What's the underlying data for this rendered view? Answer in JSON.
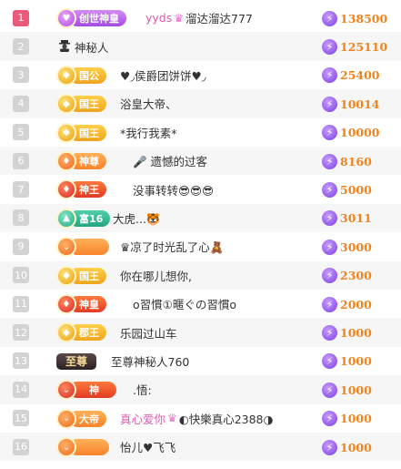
{
  "accent_color": "#f0831d",
  "score_icon": "lightning-bolt-icon",
  "rows": [
    {
      "rank": "1",
      "badge": "创世神皇",
      "badge_style": "purple",
      "name": "yyds",
      "name_suffix": "溜达溜达777",
      "name_color": "pink-prefix",
      "score": "138500"
    },
    {
      "rank": "2",
      "badge": "",
      "badge_style": "none",
      "name": "神秘人",
      "score": "125110"
    },
    {
      "rank": "3",
      "badge": "国公",
      "badge_style": "gold",
      "name": "♥◞侯爵团饼饼♥◞",
      "score": "25400"
    },
    {
      "rank": "4",
      "badge": "国王",
      "badge_style": "gold",
      "name": "浴皇大帝、",
      "score": "10014"
    },
    {
      "rank": "5",
      "badge": "国王",
      "badge_style": "gold",
      "name": "*我行我素*",
      "score": "10000"
    },
    {
      "rank": "6",
      "badge": "神尊",
      "badge_style": "orange",
      "name": "🎤 遗憾的过客",
      "score": "8160"
    },
    {
      "rank": "7",
      "badge": "神王",
      "badge_style": "red",
      "name": "没事转转😎😎😎",
      "score": "5000"
    },
    {
      "rank": "8",
      "badge": "富16",
      "badge_style": "teal",
      "name": "大虎...🐯",
      "score": "3011"
    },
    {
      "rank": "9",
      "badge": "",
      "badge_style": "orange",
      "name": "♛凉了时光乱了心🧸",
      "score": "3000"
    },
    {
      "rank": "10",
      "badge": "国王",
      "badge_style": "gold",
      "name": "你在哪儿想你,",
      "score": "2300"
    },
    {
      "rank": "11",
      "badge": "神皇",
      "badge_style": "red",
      "name": "o習慣①暱ぐの習慣o",
      "score": "2000"
    },
    {
      "rank": "12",
      "badge": "郡王",
      "badge_style": "gold",
      "name": "乐园过山车",
      "score": "1000"
    },
    {
      "rank": "13",
      "badge": "至尊",
      "badge_style": "dark",
      "name": "至尊神秘人760",
      "score": "1000"
    },
    {
      "rank": "14",
      "badge": "神",
      "badge_style": "red",
      "name": ".悟:",
      "score": "1000"
    },
    {
      "rank": "15",
      "badge": "大帝",
      "badge_style": "orange",
      "name": "真心爱你",
      "name_suffix": "◐快樂真心2388◑",
      "name_color": "pink-prefix",
      "score": "1000"
    },
    {
      "rank": "16",
      "badge": "",
      "badge_style": "orange",
      "name": "怡儿♥飞飞",
      "score": "1000"
    }
  ]
}
